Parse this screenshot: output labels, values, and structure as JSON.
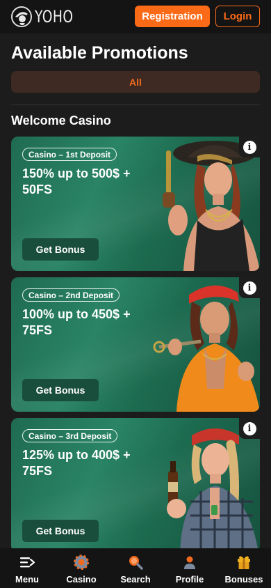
{
  "header": {
    "logo_text": "YOHO",
    "registration_label": "Registration",
    "login_label": "Login"
  },
  "page": {
    "title": "Available Promotions",
    "filter_all_label": "All",
    "section_title": "Welcome Casino"
  },
  "promotions": [
    {
      "badge": "Casino – 1st Deposit",
      "offer": "150% up to 500$ + 50FS",
      "button": "Get Bonus",
      "info_icon": "info-icon"
    },
    {
      "badge": "Casino – 2nd Deposit",
      "offer": "100% up to 450$ + 75FS",
      "button": "Get Bonus",
      "info_icon": "info-icon"
    },
    {
      "badge": "Casino – 3rd Deposit",
      "offer": "125% up to 400$ + 75FS",
      "button": "Get Bonus",
      "info_icon": "info-icon"
    }
  ],
  "bottom_nav": [
    {
      "label": "Menu",
      "icon": "menu-icon"
    },
    {
      "label": "Casino",
      "icon": "casino-chip-icon"
    },
    {
      "label": "Search",
      "icon": "search-icon"
    },
    {
      "label": "Profile",
      "icon": "profile-icon"
    },
    {
      "label": "Bonuses",
      "icon": "gift-icon"
    }
  ],
  "colors": {
    "accent": "#fb6a17",
    "background": "#1c1c1c",
    "card_green": "#2a8465"
  }
}
